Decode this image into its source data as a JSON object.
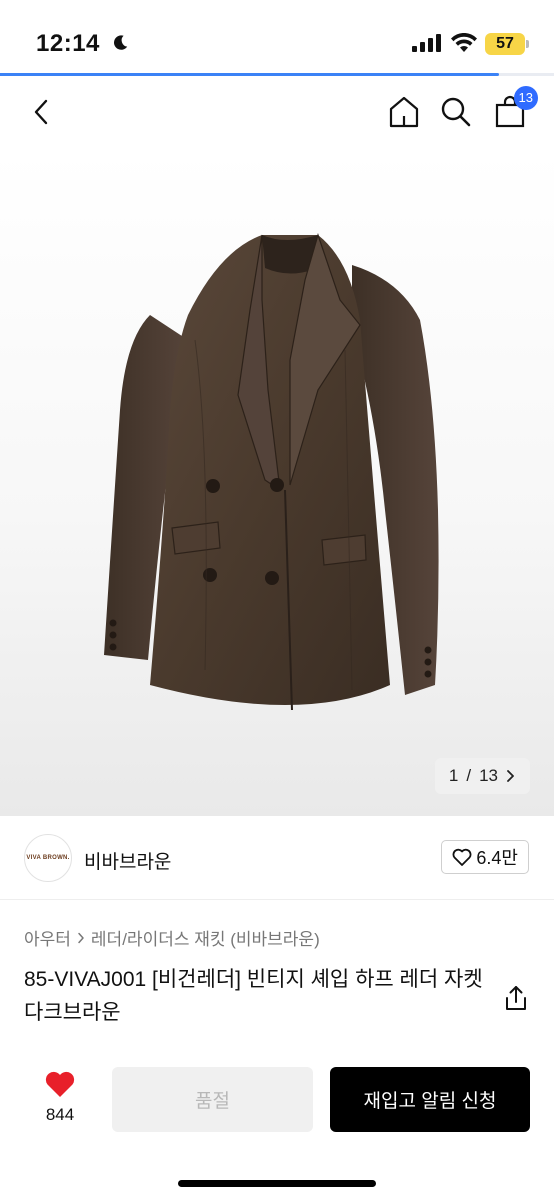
{
  "status_bar": {
    "time": "12:14",
    "battery": "57"
  },
  "page_progress": 0.9,
  "nav": {
    "cart_count": "13"
  },
  "gallery": {
    "current": "1",
    "total": "13",
    "separator": "/"
  },
  "brand": {
    "logo_text": "VIVA BROWN.",
    "name": "비바브라운",
    "like_count": "6.4만"
  },
  "breadcrumb": {
    "category": "아우터",
    "subcategory": "레더/라이더스 재킷 (비바브라운)"
  },
  "product": {
    "title": "85-VIVAJ001 [비건레더] 빈티지 셰입 하프 레더 자켓 다크브라운"
  },
  "bottom_bar": {
    "heart_count": "844",
    "soldout_label": "품절",
    "notify_label": "재입고 알림 신청"
  },
  "colors": {
    "accent": "#2f6bff",
    "progress": "#3b82f6",
    "heart": "#e8202a",
    "battery": "#f7d547",
    "jacket": "#4a3a2d"
  },
  "icons": [
    "moon-icon",
    "signal-icon",
    "wifi-icon",
    "back-icon",
    "home-icon",
    "search-icon",
    "cart-icon",
    "chevron-right-icon",
    "heart-outline-icon",
    "share-icon",
    "heart-filled-icon"
  ]
}
